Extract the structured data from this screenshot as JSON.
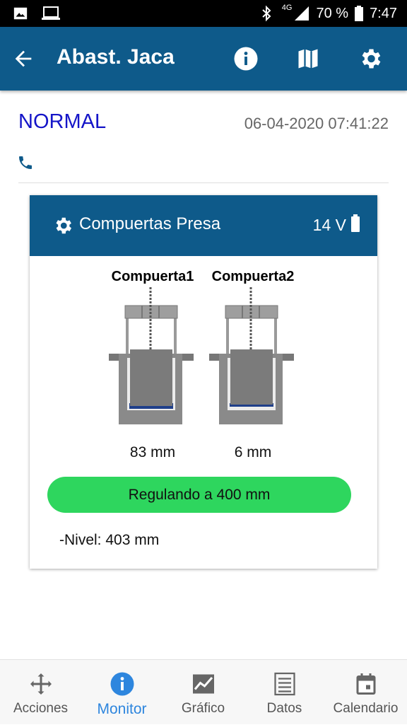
{
  "statusbar": {
    "signal_label": "4G",
    "battery_percent": "70 %",
    "time": "7:47"
  },
  "appbar": {
    "title": "Abast. Jaca",
    "icons": [
      "back-arrow-icon",
      "info-icon",
      "map-icon",
      "settings-icon"
    ]
  },
  "status": {
    "state": "NORMAL",
    "timestamp": "06-04-2020 07:41:22"
  },
  "card": {
    "title": "Compuertas Presa",
    "voltage": "14 V",
    "gates": [
      {
        "name": "Compuerta1",
        "value": "83 mm"
      },
      {
        "name": "Compuerta2",
        "value": "6 mm"
      }
    ],
    "regulating": "Regulando a 400 mm",
    "nivel": "-Nivel: 403 mm"
  },
  "bottomnav": {
    "items": [
      {
        "label": "Acciones",
        "icon": "move-arrows-icon"
      },
      {
        "label": "Monitor",
        "icon": "info-icon",
        "active": true
      },
      {
        "label": "Gráfico",
        "icon": "chart-icon"
      },
      {
        "label": "Datos",
        "icon": "list-icon"
      },
      {
        "label": "Calendario",
        "icon": "calendar-icon"
      }
    ]
  },
  "colors": {
    "primary": "#0e5a8a",
    "status": "#1515c8",
    "regulating": "#2ed65e",
    "active_nav": "#2e86de"
  }
}
